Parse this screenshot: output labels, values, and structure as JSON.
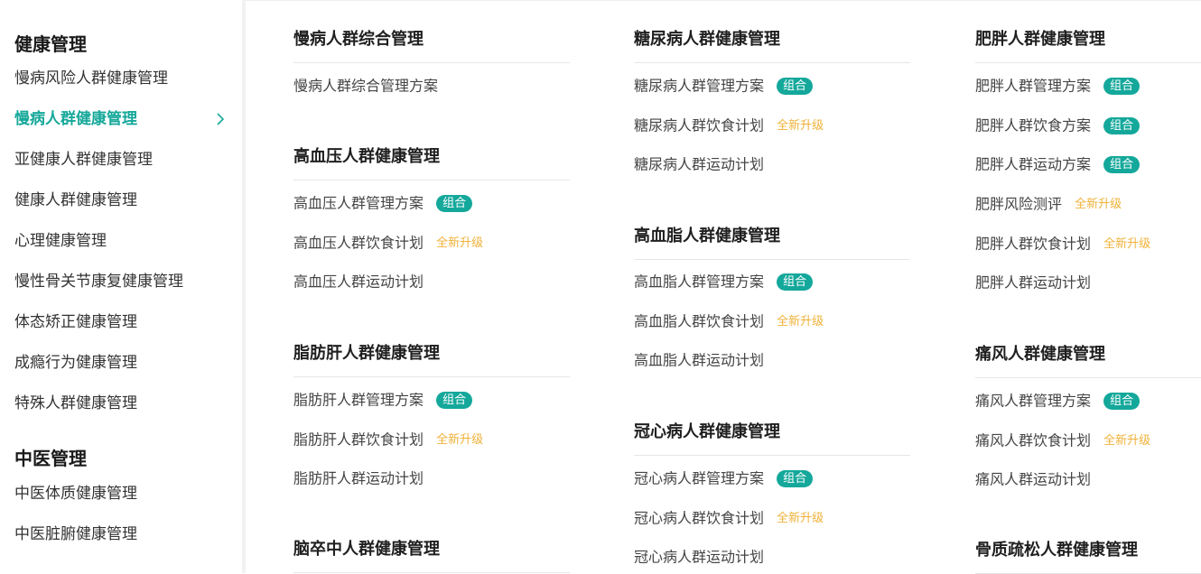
{
  "colors": {
    "accent": "#16a89a",
    "badge": "#14a89b",
    "upgrade": "#f0b23a"
  },
  "sidebar": {
    "groups": [
      {
        "title": "健康管理",
        "items": [
          {
            "label": "慢病风险人群健康管理"
          },
          {
            "label": "慢病人群健康管理",
            "active": true
          },
          {
            "label": "亚健康人群健康管理"
          },
          {
            "label": "健康人群健康管理"
          },
          {
            "label": "心理健康管理"
          },
          {
            "label": "慢性骨关节康复健康管理"
          },
          {
            "label": "体态矫正健康管理"
          },
          {
            "label": "成瘾行为健康管理"
          },
          {
            "label": "特殊人群健康管理"
          }
        ]
      },
      {
        "title": "中医管理",
        "items": [
          {
            "label": "中医体质健康管理"
          },
          {
            "label": "中医脏腑健康管理"
          }
        ]
      }
    ],
    "chevron_icon": "chevron-right-icon"
  },
  "badges": {
    "combo": "组合",
    "upgrade": "全新升级"
  },
  "columns": [
    {
      "sections": [
        {
          "title": "慢病人群综合管理",
          "items": [
            {
              "label": "慢病人群综合管理方案",
              "badge": ""
            }
          ]
        },
        {
          "title": "高血压人群健康管理",
          "items": [
            {
              "label": "高血压人群管理方案",
              "badge": "combo"
            },
            {
              "label": "高血压人群饮食计划",
              "badge": "upgrade"
            },
            {
              "label": "高血压人群运动计划",
              "badge": ""
            }
          ]
        },
        {
          "title": "脂肪肝人群健康管理",
          "items": [
            {
              "label": "脂肪肝人群管理方案",
              "badge": "combo"
            },
            {
              "label": "脂肪肝人群饮食计划",
              "badge": "upgrade"
            },
            {
              "label": "脂肪肝人群运动计划",
              "badge": ""
            }
          ]
        },
        {
          "title": "脑卒中人群健康管理",
          "items": []
        }
      ]
    },
    {
      "sections": [
        {
          "title": "糖尿病人群健康管理",
          "items": [
            {
              "label": "糖尿病人群管理方案",
              "badge": "combo"
            },
            {
              "label": "糖尿病人群饮食计划",
              "badge": "upgrade"
            },
            {
              "label": "糖尿病人群运动计划",
              "badge": ""
            }
          ]
        },
        {
          "title": "高血脂人群健康管理",
          "items": [
            {
              "label": "高血脂人群管理方案",
              "badge": "combo"
            },
            {
              "label": "高血脂人群饮食计划",
              "badge": "upgrade"
            },
            {
              "label": "高血脂人群运动计划",
              "badge": ""
            }
          ]
        },
        {
          "title": "冠心病人群健康管理",
          "items": [
            {
              "label": "冠心病人群管理方案",
              "badge": "combo"
            },
            {
              "label": "冠心病人群饮食计划",
              "badge": "upgrade"
            },
            {
              "label": "冠心病人群运动计划",
              "badge": ""
            }
          ]
        }
      ]
    },
    {
      "sections": [
        {
          "title": "肥胖人群健康管理",
          "items": [
            {
              "label": "肥胖人群管理方案",
              "badge": "combo"
            },
            {
              "label": "肥胖人群饮食方案",
              "badge": "combo"
            },
            {
              "label": "肥胖人群运动方案",
              "badge": "combo"
            },
            {
              "label": "肥胖风险测评",
              "badge": "upgrade"
            },
            {
              "label": "肥胖人群饮食计划",
              "badge": "upgrade"
            },
            {
              "label": "肥胖人群运动计划",
              "badge": ""
            }
          ]
        },
        {
          "title": "痛风人群健康管理",
          "items": [
            {
              "label": "痛风人群管理方案",
              "badge": "combo"
            },
            {
              "label": "痛风人群饮食计划",
              "badge": "upgrade"
            },
            {
              "label": "痛风人群运动计划",
              "badge": ""
            }
          ]
        },
        {
          "title": "骨质疏松人群健康管理",
          "items": []
        }
      ]
    }
  ]
}
